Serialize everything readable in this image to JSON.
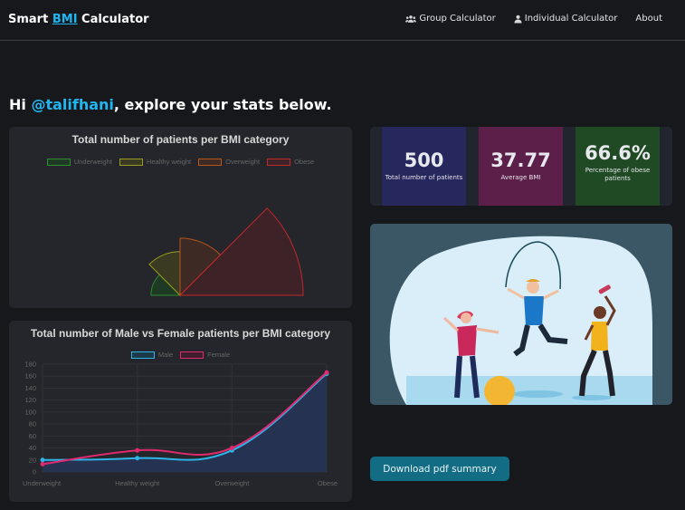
{
  "nav": {
    "brand_prefix": "Smart ",
    "brand_highlight": "BMI",
    "brand_suffix": " Calculator",
    "links": [
      {
        "label": "Group Calculator",
        "icon": "users-icon"
      },
      {
        "label": "Individual Calculator",
        "icon": "user-icon"
      },
      {
        "label": "About"
      }
    ]
  },
  "greeting": {
    "prefix": "Hi ",
    "username": "@talifhani",
    "suffix": ", explore your stats below."
  },
  "stats": [
    {
      "value": "500",
      "label": "Total number of patients",
      "bg": "#26275c"
    },
    {
      "value": "37.77",
      "label": "Average BMI",
      "bg": "#5b1f4a"
    },
    {
      "value": "66.6%",
      "label": "Percentage of obese patients",
      "bg": "#1f4a23"
    }
  ],
  "download_label": "Download pdf summary",
  "colors": {
    "accent": "#1fb6f2",
    "background": "#17181c",
    "card": "#25262b",
    "button": "#126d84"
  },
  "chart_data": [
    {
      "type": "pie",
      "subtype": "half-polar-area",
      "title": "Total number of patients per BMI category",
      "categories": [
        "Underweight",
        "Healthy weight",
        "Overweight",
        "Obese"
      ],
      "values": [
        20,
        45,
        77,
        358
      ],
      "colors": [
        "#2e8b2e",
        "#9a9a21",
        "#b5561b",
        "#c0282a"
      ],
      "fills": [
        "#1f3a24",
        "#3a3a22",
        "#3d2a24",
        "#3d2328"
      ],
      "legend_position": "top"
    },
    {
      "type": "line",
      "title": "Total number of Male vs Female patients per BMI category",
      "categories": [
        "Underweight",
        "Healthy weight",
        "Overweight",
        "Obese"
      ],
      "series": [
        {
          "name": "Male",
          "values": [
            20,
            23,
            36,
            164
          ],
          "color": "#2fb4e8"
        },
        {
          "name": "Female",
          "values": [
            13,
            36,
            40,
            166
          ],
          "color": "#e0296e"
        }
      ],
      "ylim": [
        0,
        180
      ],
      "yticks": [
        0,
        20,
        40,
        60,
        80,
        100,
        120,
        140,
        160,
        180
      ],
      "grid": true,
      "legend_position": "top"
    }
  ]
}
